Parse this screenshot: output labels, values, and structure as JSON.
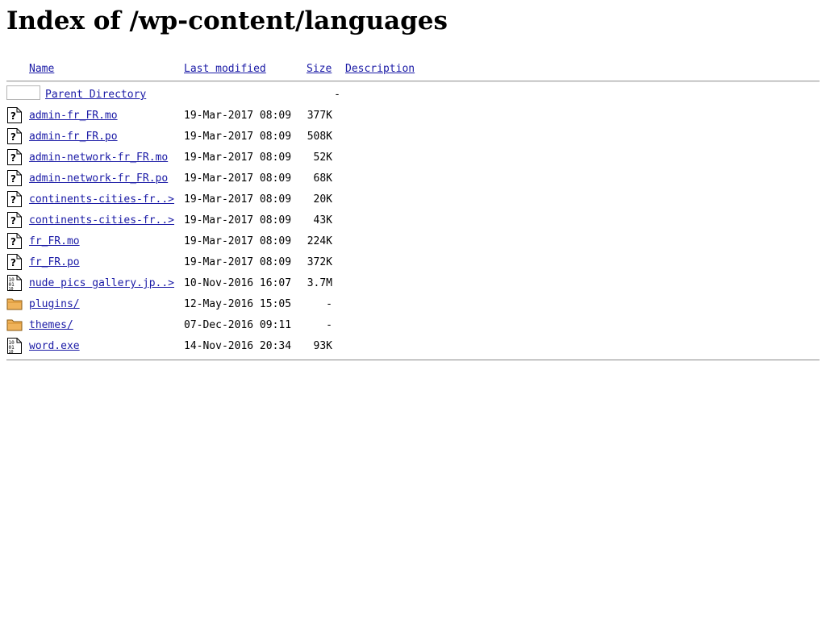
{
  "page": {
    "title": "Index of /wp-content/languages"
  },
  "columns": {
    "name": "Name",
    "last_modified": "Last modified",
    "size": "Size",
    "description": "Description"
  },
  "parent": {
    "label": "Parent Directory",
    "size": "-"
  },
  "entries": [
    {
      "name": "admin-fr_FR.mo",
      "modified": "19-Mar-2017 08:09",
      "size": "377K",
      "icon": "unknown-file-icon"
    },
    {
      "name": "admin-fr_FR.po",
      "modified": "19-Mar-2017 08:09",
      "size": "508K",
      "icon": "unknown-file-icon"
    },
    {
      "name": "admin-network-fr_FR.mo",
      "modified": "19-Mar-2017 08:09",
      "size": "52K",
      "icon": "unknown-file-icon"
    },
    {
      "name": "admin-network-fr_FR.po",
      "modified": "19-Mar-2017 08:09",
      "size": "68K",
      "icon": "unknown-file-icon"
    },
    {
      "name": "continents-cities-fr..>",
      "modified": "19-Mar-2017 08:09",
      "size": "20K",
      "icon": "unknown-file-icon"
    },
    {
      "name": "continents-cities-fr..>",
      "modified": "19-Mar-2017 08:09",
      "size": "43K",
      "icon": "unknown-file-icon"
    },
    {
      "name": "fr_FR.mo",
      "modified": "19-Mar-2017 08:09",
      "size": "224K",
      "icon": "unknown-file-icon"
    },
    {
      "name": "fr_FR.po",
      "modified": "19-Mar-2017 08:09",
      "size": "372K",
      "icon": "unknown-file-icon"
    },
    {
      "name": "nude pics gallery.jp..>",
      "modified": "10-Nov-2016 16:07",
      "size": "3.7M",
      "icon": "binary-file-icon"
    },
    {
      "name": "plugins/",
      "modified": "12-May-2016 15:05",
      "size": "-",
      "icon": "folder-icon"
    },
    {
      "name": "themes/",
      "modified": "07-Dec-2016 09:11",
      "size": "-",
      "icon": "folder-icon"
    },
    {
      "name": "word.exe",
      "modified": "14-Nov-2016 20:34",
      "size": "93K",
      "icon": "binary-file-icon"
    }
  ],
  "colors": {
    "link": "#1a1aa6",
    "folder_fill": "#f0b35a",
    "rule": "#9a9a9a"
  }
}
